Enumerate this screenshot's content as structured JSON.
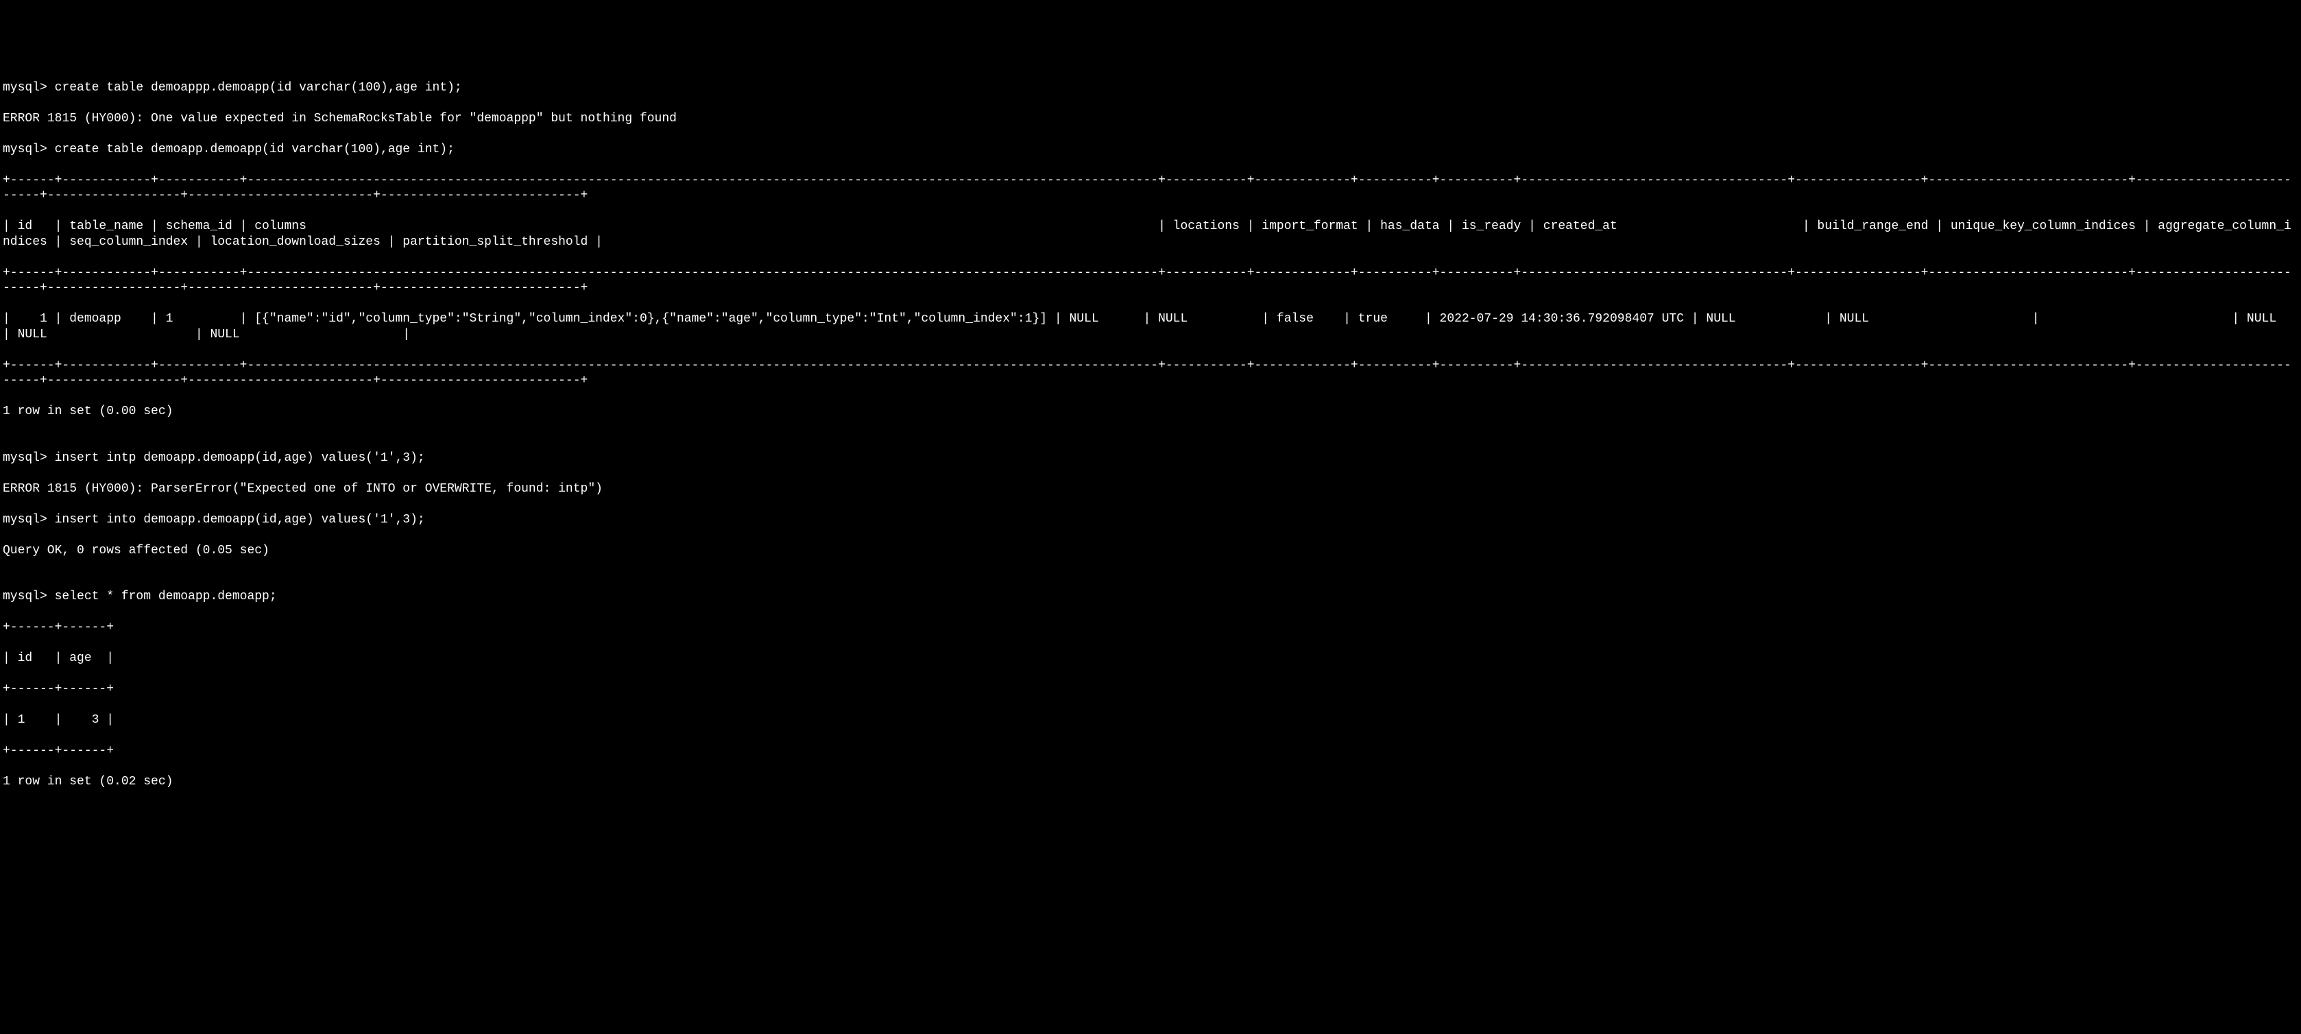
{
  "terminal": {
    "lines": [
      "mysql> create table demoappp.demoapp(id varchar(100),age int);",
      "ERROR 1815 (HY000): One value expected in SchemaRocksTable for \"demoappp\" but nothing found",
      "mysql> create table demoapp.demoapp(id varchar(100),age int);",
      "+------+------------+-----------+---------------------------------------------------------------------------------------------------------------------------+-----------+-------------+----------+----------+------------------------------------+-----------------+---------------------------+--------------------------+------------------+-------------------------+---------------------------+",
      "| id   | table_name | schema_id | columns                                                                                                                   | locations | import_format | has_data | is_ready | created_at                         | build_range_end | unique_key_column_indices | aggregate_column_indices | seq_column_index | location_download_sizes | partition_split_threshold |",
      "+------+------------+-----------+---------------------------------------------------------------------------------------------------------------------------+-----------+-------------+----------+----------+------------------------------------+-----------------+---------------------------+--------------------------+------------------+-------------------------+---------------------------+",
      "|    1 | demoapp    | 1         | [{\"name\":\"id\",\"column_type\":\"String\",\"column_index\":0},{\"name\":\"age\",\"column_type\":\"Int\",\"column_index\":1}] | NULL      | NULL          | false    | true     | 2022-07-29 14:30:36.792098407 UTC | NULL            | NULL                      |                          | NULL             | NULL                    | NULL                      |",
      "+------+------------+-----------+---------------------------------------------------------------------------------------------------------------------------+-----------+-------------+----------+----------+------------------------------------+-----------------+---------------------------+--------------------------+------------------+-------------------------+---------------------------+",
      "1 row in set (0.00 sec)",
      "",
      "mysql> insert intp demoapp.demoapp(id,age) values('1',3);",
      "ERROR 1815 (HY000): ParserError(\"Expected one of INTO or OVERWRITE, found: intp\")",
      "mysql> insert into demoapp.demoapp(id,age) values('1',3);",
      "Query OK, 0 rows affected (0.05 sec)",
      "",
      "mysql> select * from demoapp.demoapp;",
      "+------+------+",
      "| id   | age  |",
      "+------+------+",
      "| 1    |    3 |",
      "+------+------+",
      "1 row in set (0.02 sec)"
    ]
  }
}
